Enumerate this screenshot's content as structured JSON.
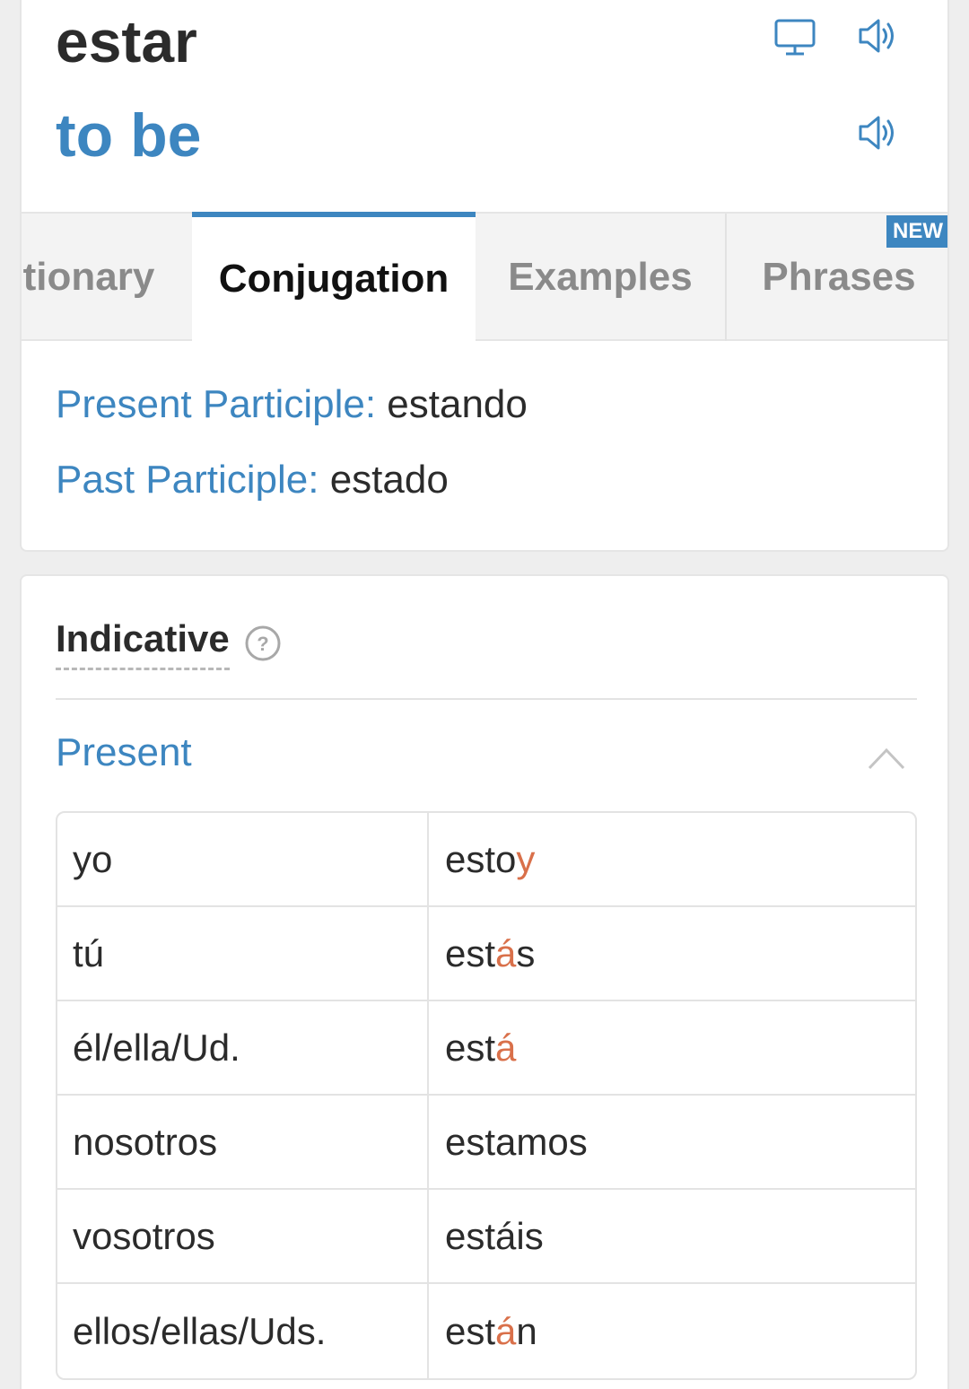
{
  "header": {
    "word": "estar",
    "translation": "to be"
  },
  "icons": {
    "display": "monitor-icon",
    "speaker": "speaker-icon",
    "help": "question-circle-icon",
    "collapse": "chevron-up-icon"
  },
  "tabs": [
    {
      "label": "tionary",
      "active": false
    },
    {
      "label": "Conjugation",
      "active": true
    },
    {
      "label": "Examples",
      "active": false
    },
    {
      "label": "Phrases",
      "active": false,
      "badge": "NEW"
    }
  ],
  "participles": {
    "present_label": "Present Participle:",
    "present_value": "estando",
    "past_label": "Past Participle:",
    "past_value": "estado"
  },
  "mood": {
    "title": "Indicative",
    "help": "?"
  },
  "tense": {
    "title": "Present",
    "rows": [
      {
        "pronoun": "yo",
        "stem": "esto",
        "ending": "y",
        "rest": ""
      },
      {
        "pronoun": "tú",
        "stem": "est",
        "ending": "á",
        "rest": "s"
      },
      {
        "pronoun": "él/ella/Ud.",
        "stem": "est",
        "ending": "á",
        "rest": ""
      },
      {
        "pronoun": "nosotros",
        "stem": "estamos",
        "ending": "",
        "rest": ""
      },
      {
        "pronoun": "vosotros",
        "stem": "estáis",
        "ending": "",
        "rest": ""
      },
      {
        "pronoun": "ellos/ellas/Uds.",
        "stem": "est",
        "ending": "á",
        "rest": "n"
      }
    ]
  },
  "colors": {
    "accent": "#3d86c0",
    "irregular": "#d9704a",
    "text": "#2b2b2b"
  }
}
